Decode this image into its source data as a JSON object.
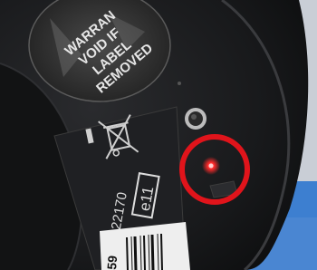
{
  "warranty_sticker": {
    "lines": [
      "WARRAN",
      "VOID IF",
      "LABEL",
      "REMOVED"
    ]
  },
  "device_label": {
    "code": "022170",
    "mark": "e11",
    "barcode_digits": "59"
  },
  "colors": {
    "device_body": "#1b1c1e",
    "indicator_led": "#ff2a2a",
    "highlight_circle": "#e0141b",
    "background_blue": "#3d7fd0"
  },
  "icons": {
    "weee": "crossed-out-wheelie-bin-icon"
  }
}
